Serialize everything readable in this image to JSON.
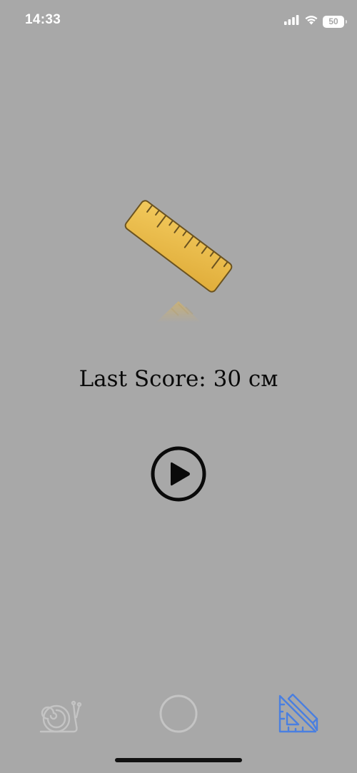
{
  "status_bar": {
    "time": "14:33",
    "battery_level": "50",
    "icons": [
      "signal-icon",
      "wifi-icon",
      "battery-icon"
    ]
  },
  "main": {
    "illustration": "ruler-icon",
    "score_text": "Last Score: 30 см",
    "play_button_icon": "play-circle-icon"
  },
  "tab_bar": {
    "tabs": [
      {
        "icon": "snail-icon",
        "active": false
      },
      {
        "icon": "circle-icon",
        "active": false
      },
      {
        "icon": "ruler-triangle-icon",
        "active": true
      }
    ]
  },
  "colors": {
    "background": "#a8a8a8",
    "ruler_fill": "#e9b94a",
    "ruler_stroke": "#6b5320",
    "active_tab": "#4a7fe0",
    "inactive_tab": "#c4c4c4"
  }
}
